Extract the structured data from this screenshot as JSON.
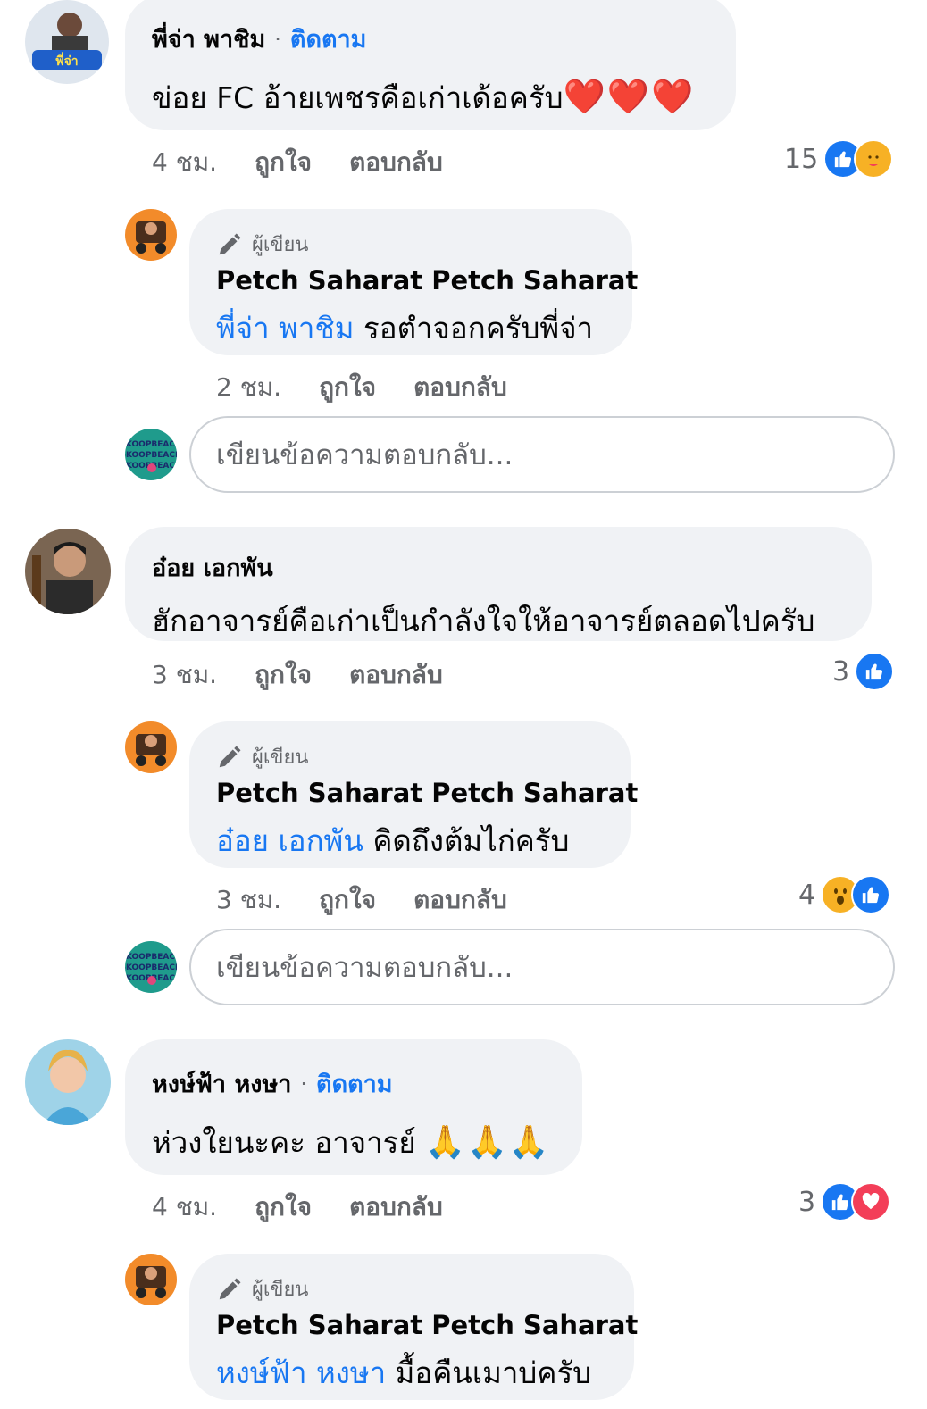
{
  "comments": [
    {
      "name": "พี่จ่า พาชิม",
      "follow": "ติดตาม",
      "text": "ข่อย FC อ้ายเพชรคือเก่าเด้อครับ",
      "emoji": "❤️❤️❤️",
      "time": "4 ชม.",
      "like": "ถูกใจ",
      "reply": "ตอบกลับ",
      "reaction_count": "15",
      "reactions": [
        "like-icon",
        "care-icon"
      ],
      "reply_comment": {
        "badge": "ผู้เขียน",
        "name": "Petch Saharat Petch Saharat",
        "mention": "พี่จ่า พาชิม",
        "text": "รอตำจอกครับพี่จ่า",
        "time": "2 ชม.",
        "like": "ถูกใจ",
        "reply": "ตอบกลับ"
      },
      "reply_placeholder": "เขียนข้อความตอบกลับ..."
    },
    {
      "name": "อ๋อย เอกพัน",
      "text": "ฮักอาจารย์คือเก่าเป็นกำลังใจให้อาจารย์ตลอดไปครับ",
      "time": "3 ชม.",
      "like": "ถูกใจ",
      "reply": "ตอบกลับ",
      "reaction_count": "3",
      "reactions": [
        "like-icon"
      ],
      "reply_comment": {
        "badge": "ผู้เขียน",
        "name": "Petch Saharat Petch Saharat",
        "mention": "อ๋อย เอกพัน",
        "text": "คิดถึงต้มไก่ครับ",
        "time": "3 ชม.",
        "like": "ถูกใจ",
        "reply": "ตอบกลับ",
        "reaction_count": "4",
        "reactions": [
          "wow-icon",
          "like-icon"
        ]
      },
      "reply_placeholder": "เขียนข้อความตอบกลับ..."
    },
    {
      "name": "หงษ์ฟ้า หงษา",
      "follow": "ติดตาม",
      "text": "ห่วงใยนะคะ อาจารย์",
      "emoji": "🙏🙏🙏",
      "time": "4 ชม.",
      "like": "ถูกใจ",
      "reply": "ตอบกลับ",
      "reaction_count": "3",
      "reactions": [
        "like-icon",
        "love-icon"
      ],
      "reply_comment": {
        "badge": "ผู้เขียน",
        "name": "Petch Saharat Petch Saharat",
        "mention": "หงษ์ฟ้า หงษา",
        "text": "มื้อคืนเมาบ่ครับ"
      }
    }
  ],
  "colors": {
    "bubble": "#f0f2f5",
    "link": "#1877f2",
    "meta": "#65676b",
    "like": "#1877f2",
    "love": "#f33e58"
  }
}
